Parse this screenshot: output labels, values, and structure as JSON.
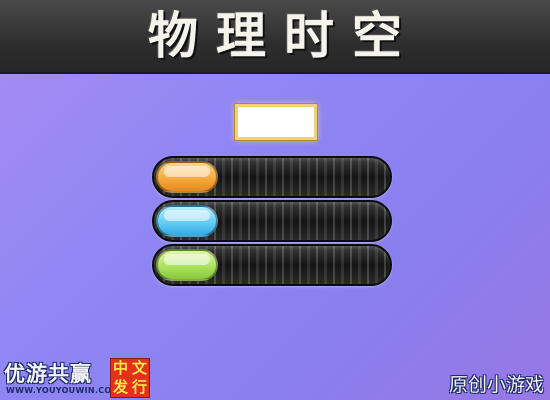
{
  "header": {
    "title": "物理时空"
  },
  "score": {
    "value": ""
  },
  "bars": [
    {
      "name": "orange",
      "color": "#f5a63a"
    },
    {
      "name": "blue",
      "color": "#5fc8f5"
    },
    {
      "name": "green",
      "color": "#a8e05a"
    }
  ],
  "footer": {
    "publisher_name": "优游共赢",
    "publisher_url": "WWW.YOUYOUWIN.COM",
    "badge": [
      "中",
      "文",
      "发",
      "行"
    ],
    "tagline": "原创小游戏"
  }
}
